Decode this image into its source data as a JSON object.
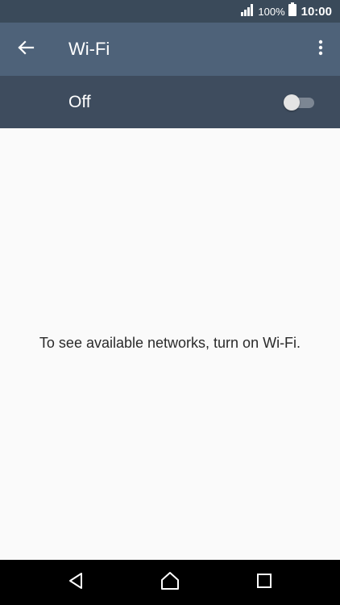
{
  "status_bar": {
    "battery": "100%",
    "time": "10:00"
  },
  "app_bar": {
    "title": "Wi-Fi",
    "icons": [
      "arrow-back-icon",
      "more-vert-icon"
    ]
  },
  "wifi_switch": {
    "label": "Off",
    "checked": false
  },
  "main": {
    "empty_message": "To see available networks, turn on Wi-Fi."
  },
  "nav_bar": {
    "icons": [
      "back-triangle-icon",
      "home-icon",
      "recents-square-icon"
    ]
  },
  "colors": {
    "status_bar": "#3a4a5a",
    "app_bar": "#4e6279",
    "switch_bar": "#3e4c5e",
    "background": "#fafafa",
    "nav_bar": "#000000"
  }
}
